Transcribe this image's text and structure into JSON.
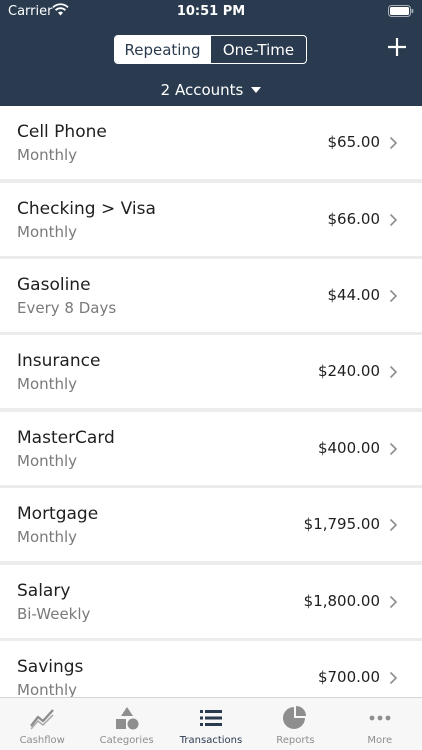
{
  "status": {
    "carrier": "Carrier",
    "time": "10:51 PM"
  },
  "header": {
    "segments": [
      "Repeating",
      "One-Time"
    ],
    "accounts_label": "2 Accounts"
  },
  "transactions": [
    {
      "name": "Cell Phone",
      "frequency": "Monthly",
      "amount": "$65.00"
    },
    {
      "name": "Checking > Visa",
      "frequency": "Monthly",
      "amount": "$66.00"
    },
    {
      "name": "Gasoline",
      "frequency": "Every 8 Days",
      "amount": "$44.00"
    },
    {
      "name": "Insurance",
      "frequency": "Monthly",
      "amount": "$240.00"
    },
    {
      "name": "MasterCard",
      "frequency": "Monthly",
      "amount": "$400.00"
    },
    {
      "name": "Mortgage",
      "frequency": "Monthly",
      "amount": "$1,795.00"
    },
    {
      "name": "Salary",
      "frequency": "Bi-Weekly",
      "amount": "$1,800.00"
    },
    {
      "name": "Savings",
      "frequency": "Monthly",
      "amount": "$700.00"
    }
  ],
  "tabs": [
    {
      "label": "Cashflow",
      "icon": "cashflow-icon"
    },
    {
      "label": "Categories",
      "icon": "categories-icon"
    },
    {
      "label": "Transactions",
      "icon": "transactions-icon",
      "active": true
    },
    {
      "label": "Reports",
      "icon": "reports-icon"
    },
    {
      "label": "More",
      "icon": "more-icon"
    }
  ],
  "colors": {
    "header": "#2a3b4f",
    "active_tab": "#2a3b4f",
    "inactive_tab": "#8e8e8e"
  }
}
